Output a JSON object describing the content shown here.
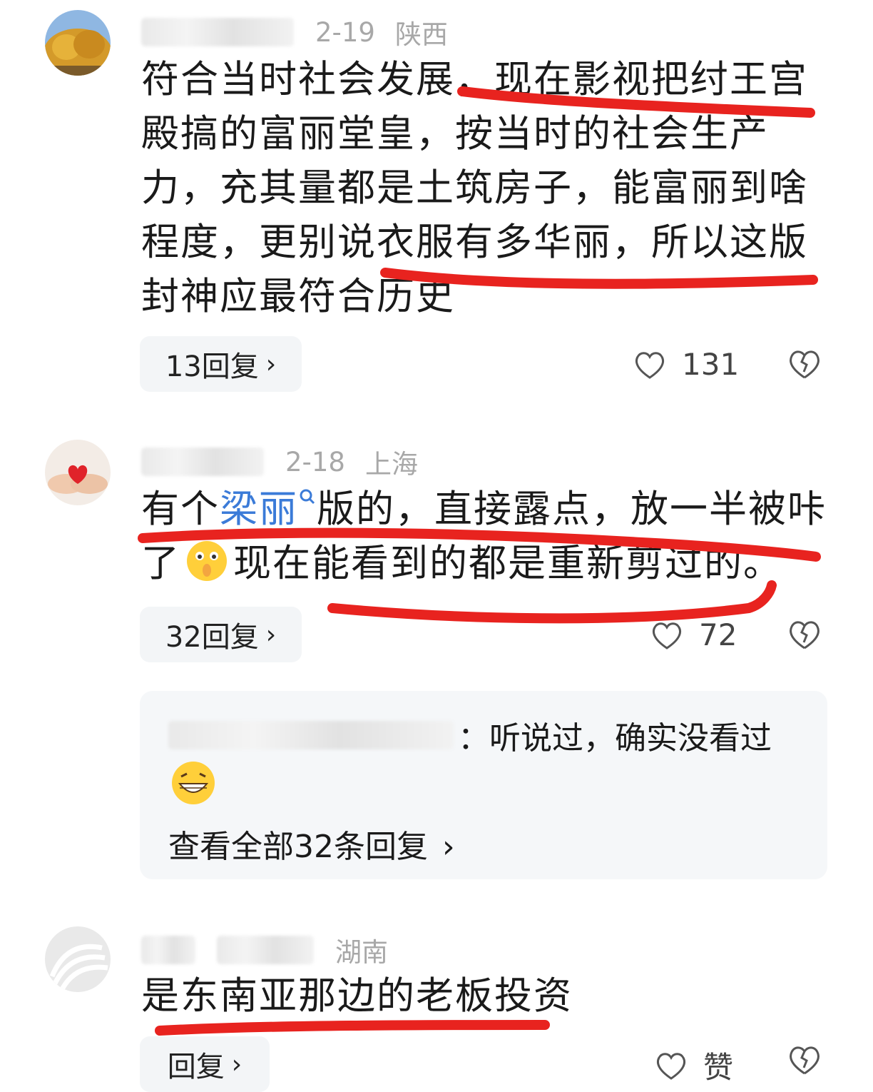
{
  "comments": [
    {
      "date": "2-19",
      "location": "陕西",
      "text": "符合当时社会发展，现在影视把纣王宫殿搞的富丽堂皇，按当时的社会生产力，充其量都是土筑房子，能富丽到啥程度，更别说衣服有多华丽，所以这版封神应最符合历史",
      "replies_label": "13回复",
      "likes": "131"
    },
    {
      "date": "2-18",
      "location": "上海",
      "text_prefix": "有个",
      "link_text": "梁丽",
      "text_mid": "版的，直接露点，放一半被咔了",
      "text_suffix": "现在能看到的都是重新剪过的。",
      "replies_label": "32回复",
      "likes": "72",
      "sub_reply": {
        "text": "：听说过，确实没看过",
        "view_all": "查看全部32条回复"
      }
    },
    {
      "location": "湖南",
      "text": "是东南亚那边的老板投资",
      "replies_label": "回复",
      "likes": "赞"
    }
  ],
  "colors": {
    "highlight": "#e8231f",
    "link": "#3b7bd8",
    "meta": "#a8a8a8"
  },
  "icons": [
    "heart-outline-icon",
    "broken-heart-icon",
    "chevron-right-icon",
    "search-icon",
    "emoji-shy-icon",
    "emoji-grin-icon"
  ]
}
